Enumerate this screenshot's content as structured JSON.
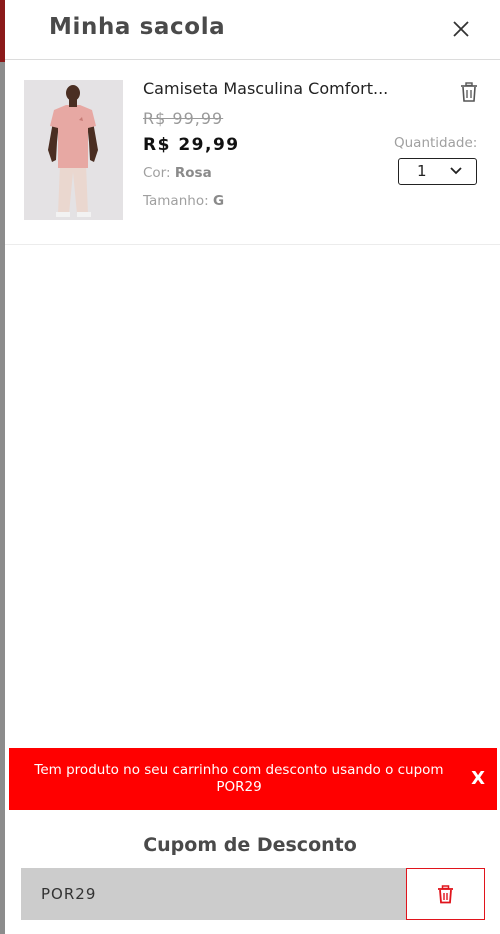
{
  "header": {
    "title": "Minha sacola",
    "close_icon": "close-icon"
  },
  "cart_item": {
    "name": "Camiseta Masculina Comfort...",
    "old_price": "R$ 99,99",
    "price": "R$ 29,99",
    "color_label": "Cor:",
    "color_value": "Rosa",
    "size_label": "Tamanho:",
    "size_value": "G",
    "quantity_label": "Quantidade:",
    "quantity_value": "1",
    "delete_icon": "trash-icon"
  },
  "alert": {
    "message": "Tem produto no seu carrinho com desconto usando o cupom POR29",
    "close_label": "X",
    "color": "#ff0000"
  },
  "coupon": {
    "title": "Cupom de Desconto",
    "code": "POR29",
    "remove_icon": "trash-icon",
    "accent": "#e0141c"
  }
}
